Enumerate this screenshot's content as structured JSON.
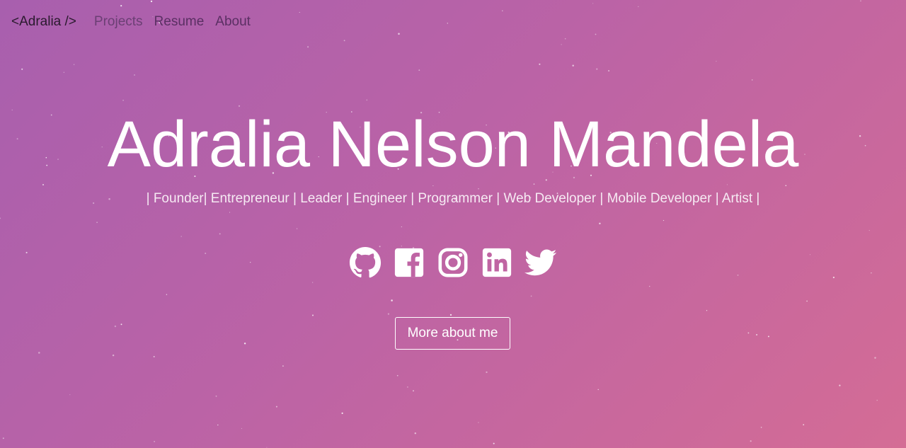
{
  "colors": {
    "gradient_start": "#a85fae",
    "gradient_end": "#d46c95",
    "text": "#ffffff",
    "brand": "#2a1a2e"
  },
  "navbar": {
    "brand": "<Adralia />",
    "links": [
      {
        "label": "Projects"
      },
      {
        "label": "Resume"
      },
      {
        "label": "About"
      }
    ]
  },
  "hero": {
    "title": "Adralia Nelson Mandela",
    "tagline": "| Founder| Entrepreneur | Leader | Engineer | Programmer | Web Developer | Mobile Developer | Artist |"
  },
  "social": [
    {
      "icon": "github-icon"
    },
    {
      "icon": "facebook-icon"
    },
    {
      "icon": "instagram-icon"
    },
    {
      "icon": "linkedin-icon"
    },
    {
      "icon": "twitter-icon"
    }
  ],
  "cta": {
    "label": "More about me"
  }
}
